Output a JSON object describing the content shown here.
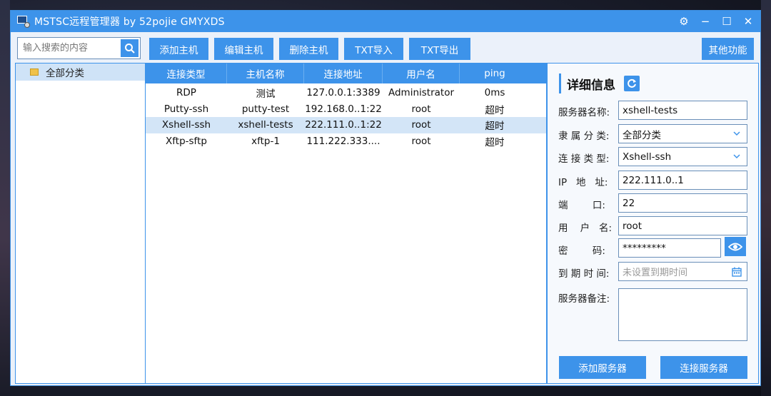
{
  "window": {
    "title": "MSTSC远程管理器 by 52pojie GMYXDS"
  },
  "window_controls": {
    "settings": "⚙",
    "minimize": "−",
    "maximize": "☐",
    "close": "✕"
  },
  "search": {
    "placeholder": "输入搜索的内容"
  },
  "toolbar": {
    "add_host": "添加主机",
    "edit_host": "编辑主机",
    "delete_host": "删除主机",
    "txt_import": "TXT导入",
    "txt_export": "TXT导出",
    "other": "其他功能"
  },
  "tree": {
    "items": [
      {
        "label": "全部分类"
      }
    ]
  },
  "table": {
    "headers": [
      "连接类型",
      "主机名称",
      "连接地址",
      "用户名",
      "ping"
    ],
    "rows": [
      {
        "type": "RDP",
        "name": "测试",
        "addr": "127.0.0.1:3389",
        "user": "Administrator",
        "ping": "0ms"
      },
      {
        "type": "Putty-ssh",
        "name": "putty-test",
        "addr": "192.168.0..1:22",
        "user": "root",
        "ping": "超时"
      },
      {
        "type": "Xshell-ssh",
        "name": "xshell-tests",
        "addr": "222.111.0..1:22",
        "user": "root",
        "ping": "超时"
      },
      {
        "type": "Xftp-sftp",
        "name": "xftp-1",
        "addr": "111.222.333....",
        "user": "root",
        "ping": "超时"
      }
    ]
  },
  "detail": {
    "title": "详细信息",
    "labels": {
      "server_name": "服务器名称:",
      "category": "隶 属 分 类:",
      "conn_type": "连 接 类 型:",
      "ip": "IP   地   址:",
      "port": "端        口:",
      "user": "用    户   名:",
      "password": "密        码:",
      "expire": "到 期 时 间:",
      "note": "服务器备注:"
    },
    "values": {
      "server_name": "xshell-tests",
      "category": "全部分类",
      "conn_type": "Xshell-ssh",
      "ip": "222.111.0..1",
      "port": "22",
      "user": "root",
      "password": "*********",
      "expire_placeholder": "未设置到期时间",
      "note": ""
    },
    "buttons": {
      "add": "添加服务器",
      "connect": "连接服务器"
    }
  },
  "colors": {
    "accent": "#3d93ea",
    "selected_row": "#d3e5f7",
    "panel_bg": "#ebf1fa"
  }
}
